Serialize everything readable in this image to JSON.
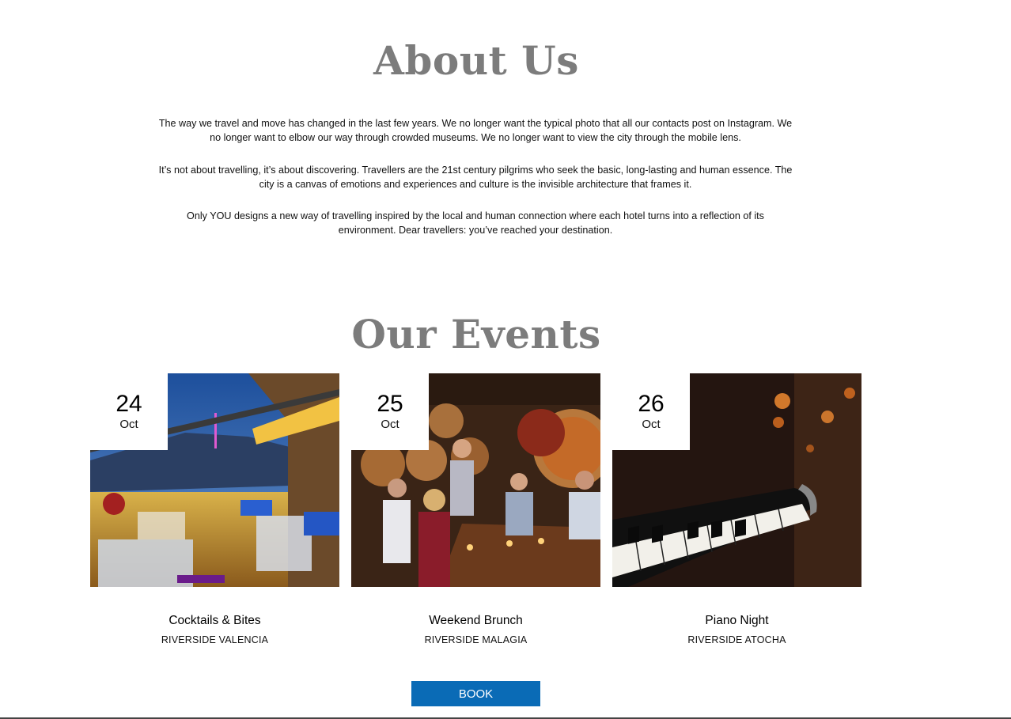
{
  "about": {
    "title": "About Us",
    "paragraphs": [
      "The way we travel and move has changed in the last few years. We no longer want the typical photo that all our contacts post on Instagram. We no longer want to elbow our way through crowded museums. We no longer want to view the city through the mobile lens.",
      "It’s not about travelling, it’s about discovering. Travellers are the 21st century pilgrims who seek the basic, long-lasting and human essence. The city is a canvas of emotions and experiences and culture is the invisible architecture that frames it.",
      "Only YOU designs a new way of travelling inspired by the local and human connection where each hotel turns into a reflection of its environment. Dear travellers: you’ve reached your destination."
    ]
  },
  "events": {
    "title": "Our Events",
    "items": [
      {
        "day": "24",
        "month": "Oct",
        "name": "Cocktails & Bites",
        "location": "RIVERSIDE VALENCIA"
      },
      {
        "day": "25",
        "month": "Oct",
        "name": "Weekend Brunch",
        "location": "RIVERSIDE MALAGIA"
      },
      {
        "day": "26",
        "month": "Oct",
        "name": "Piano Night",
        "location": "RIVERSIDE ATOCHA"
      }
    ]
  },
  "book_button": {
    "label": "BOOK"
  },
  "colors": {
    "title": "#7c7c7c",
    "button": "#0a6bb6"
  }
}
